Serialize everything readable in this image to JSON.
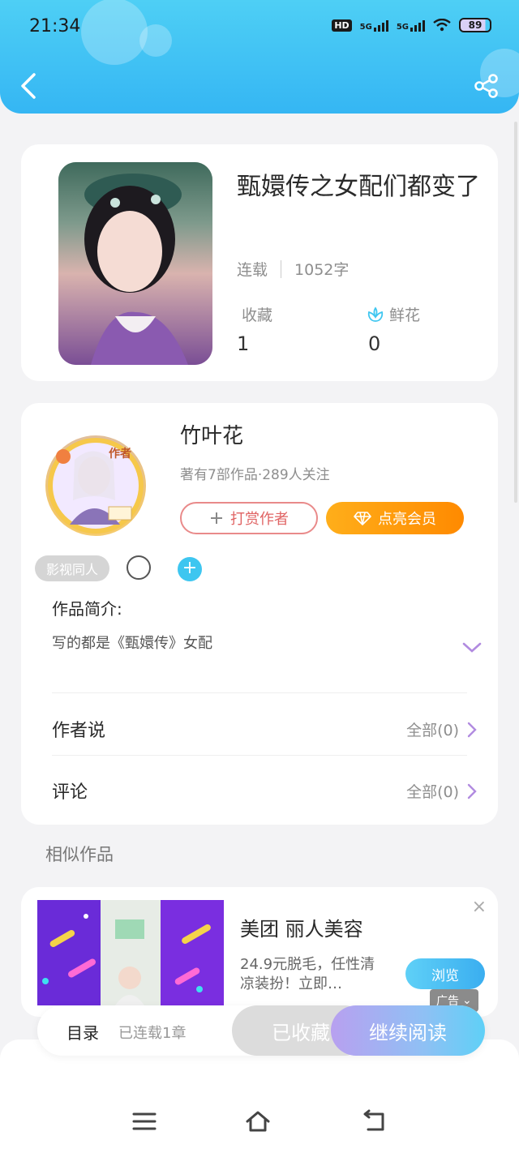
{
  "status_bar": {
    "time": "21:34",
    "hd_label": "HD",
    "net1": "5G",
    "net2": "5G",
    "battery": "89"
  },
  "book": {
    "title": "甄嬛传之女配们都变了",
    "status": "连载",
    "word_count": "1052字",
    "favorites_label": "收藏",
    "favorites_value": "1",
    "flowers_label": "鲜花",
    "flowers_value": "0"
  },
  "author": {
    "badge": "作者",
    "name": "竹叶花",
    "stats": "著有7部作品·289人关注",
    "reward_button": "打赏作者",
    "vip_button": "点亮会员",
    "tag": "影视同人",
    "add_tag": "+"
  },
  "intro": {
    "label": "作品简介:",
    "text": "写的都是《甄嬛传》女配"
  },
  "rows": {
    "author_says": "作者说",
    "author_says_more": "全部(0)",
    "comments": "评论",
    "comments_more": "全部(0)"
  },
  "similar": {
    "title": "相似作品"
  },
  "ad": {
    "title": "美团 丽人美容",
    "desc": "24.9元脱毛，任性清凉装扮！立即…",
    "browse": "浏览",
    "tag": "广告",
    "close": "×"
  },
  "read_bar": {
    "toc": "目录",
    "toc_status": "已连载1章",
    "collected": "已收藏",
    "continue": "继续阅读"
  },
  "colors": {
    "accent": "#35b6f3",
    "vip": "#ff8a00",
    "reward": "#e06464"
  }
}
